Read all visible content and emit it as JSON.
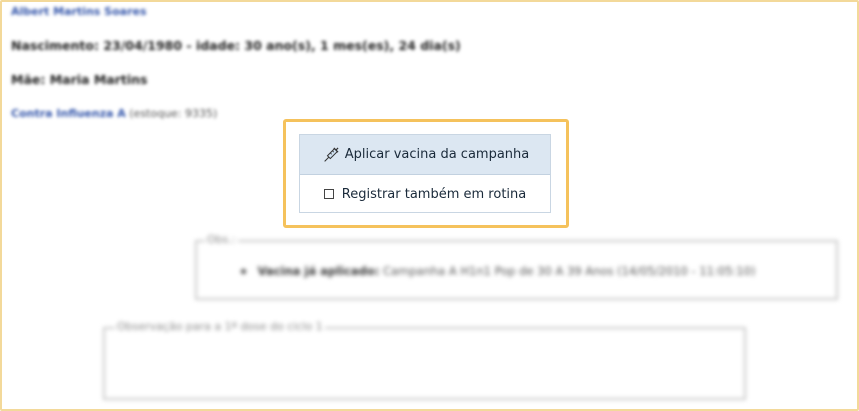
{
  "patient": {
    "name": "Albert Martins Soares",
    "birth_line": "Nascimento: 23/04/1980 - idade: 30 ano(s), 1 mes(es), 24 dia(s)",
    "mother_line": "Mãe: Maria Martins"
  },
  "vaccine_stock": {
    "name": "Contra Influenza A",
    "stock": "(estoque: 9335)"
  },
  "actions": {
    "apply_label": "Aplicar vacina da campanha",
    "apply_icon": "syringe-icon",
    "routine_label": "Registrar também em rotina",
    "routine_checked": false
  },
  "observations": {
    "legend": "Obs.:",
    "items": [
      {
        "label": "Vacina já aplicado:",
        "text": "Campanha A H1n1 Pop de 30 A 39 Anos (14/05/2010 - 11:05:10)"
      }
    ]
  },
  "dose_note": {
    "legend": "Observação para a 1ª dose do ciclo 1",
    "value": ""
  },
  "colors": {
    "highlight_border": "#f5c25c",
    "button_bg": "#dce7f2",
    "link": "#3355aa"
  }
}
